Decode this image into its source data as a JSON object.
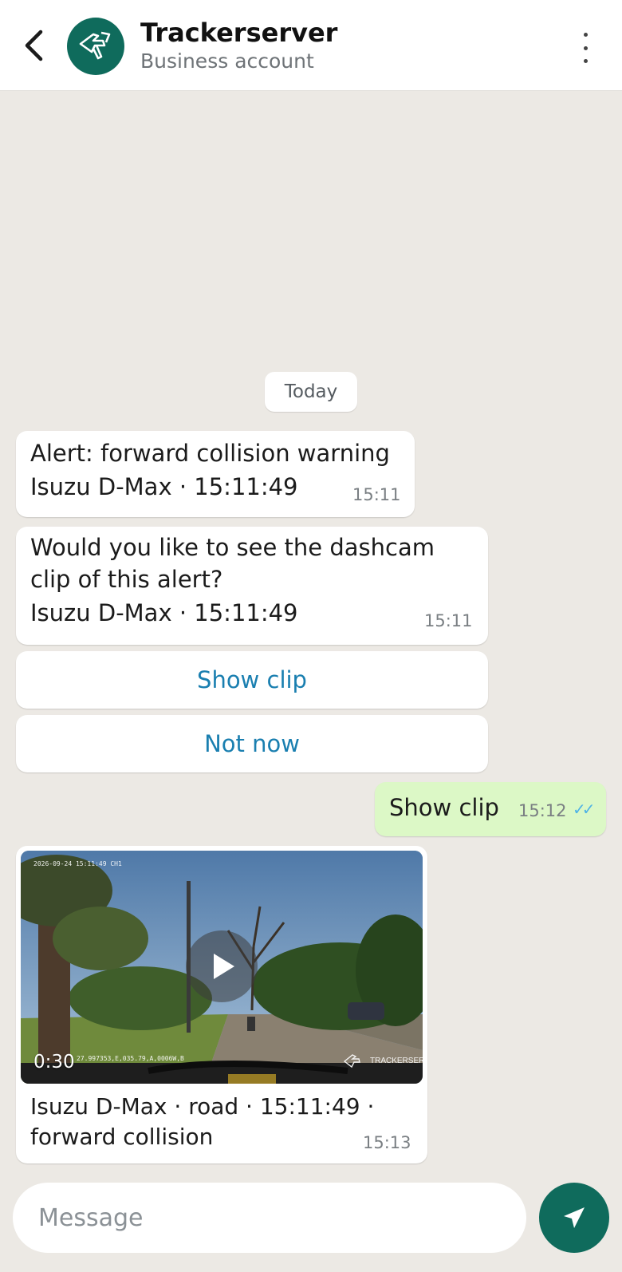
{
  "header": {
    "title": "Trackerserver",
    "subtitle": "Business account",
    "back_icon": "chevron-left-icon",
    "menu_icon": "more-vertical-icon",
    "avatar_color": "#0f6b5c"
  },
  "date_chip": "Today",
  "messages": [
    {
      "direction": "in",
      "lines": [
        "Alert: forward collision warning",
        "Isuzu D-Max · 15:11:49"
      ],
      "time": "15:11"
    },
    {
      "direction": "in",
      "lines": [
        "Would you like to see the dashcam",
        "clip of this alert?",
        "Isuzu D-Max · 15:11:49"
      ],
      "time": "15:11"
    },
    {
      "direction": "out",
      "text": "Show clip",
      "time": "15:12",
      "read_ticks": "✓✓"
    },
    {
      "direction": "in",
      "type": "video",
      "duration": "0:30",
      "caption": "Isuzu D-Max · road · 15:11:49 · forward collision",
      "time": "15:13",
      "video_overlay_timestamp": "2026-09-24 15:11:49 CH1",
      "video_overlay_coords": "27.997353,E,035.79,A,0006W,B",
      "video_watermark": "TRACKERSERVER"
    }
  ],
  "quick_replies": [
    "Show clip",
    "Not now"
  ],
  "compose": {
    "placeholder": "Message",
    "send_icon": "send-icon"
  },
  "colors": {
    "background": "#ece9e4",
    "outgoing_bubble": "#dcf8c6",
    "quick_reply_text": "#1a7fb0",
    "brand": "#0f6b5c",
    "read_ticks": "#4fb3e6"
  }
}
